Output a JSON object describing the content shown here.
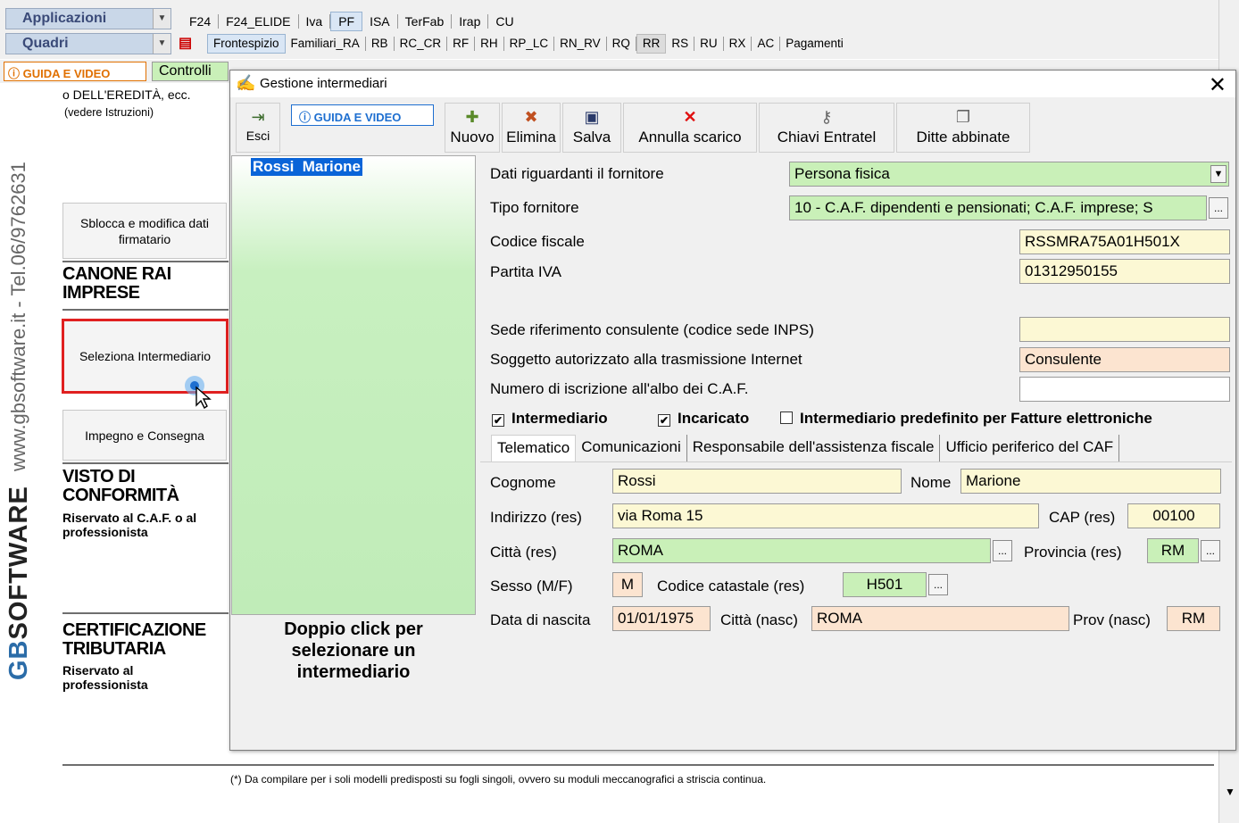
{
  "topbar": {
    "combo1": "Applicazioni",
    "combo2": "Quadri",
    "row1_tabs": [
      "F24",
      "F24_ELIDE",
      "Iva",
      "PF",
      "ISA",
      "TerFab",
      "Irap",
      "CU"
    ],
    "row1_active": "PF",
    "row2_tabs": [
      "Frontespizio",
      "Familiari_RA",
      "RB",
      "RC_CR",
      "RF",
      "RH",
      "RP_LC",
      "RN_RV",
      "RQ",
      "RR",
      "RS",
      "RU",
      "RX",
      "AC",
      "Pagamenti"
    ],
    "row2_active": "RR"
  },
  "subbar": {
    "guida": "GUIDA E VIDEO",
    "controlli": "Controlli"
  },
  "side": {
    "vertical_text": "www.gbsoftware.it - Tel.06/9762631",
    "brand": "SOFTWARE",
    "brand_prefix": "GB"
  },
  "left_form": {
    "eredita": "o DELL'EREDITÀ, ecc.",
    "istruzioni": "(vedere Istruzioni)",
    "sblocca_button": "Sblocca e modifica dati firmatario",
    "canone_title": "CANONE RAI IMPRESE",
    "seleziona_button": "Seleziona Intermediario",
    "impegno_button": "Impegno e Consegna",
    "visto_title": "VISTO DI CONFORMITÀ",
    "visto_sub": "Riservato al C.A.F. o al professionista",
    "cert_title": "CERTIFICAZIONE TRIBUTARIA",
    "cert_sub": "Riservato al professionista",
    "footnote": "(*) Da compilare per i soli modelli predisposti su fogli singoli, ovvero su moduli meccanografici a striscia continua."
  },
  "dialog": {
    "title": "Gestione intermediari",
    "toolbar": {
      "esci": "Esci",
      "guida": "GUIDA E VIDEO",
      "nuovo": "Nuovo",
      "elimina": "Elimina",
      "salva": "Salva",
      "annulla": "Annulla scarico",
      "chiavi": "Chiavi Entratel",
      "ditte": "Ditte abbinate"
    },
    "list": {
      "selected": "Rossi  Marione",
      "hint": "Doppio click per selezionare un intermediario"
    },
    "form": {
      "dati_label": "Dati riguardanti il fornitore",
      "dati_value": "Persona fisica",
      "tipo_label": "Tipo fornitore",
      "tipo_value": "10 - C.A.F. dipendenti e pensionati; C.A.F. imprese; S",
      "cf_label": "Codice fiscale",
      "cf_value": "RSSMRA75A01H501X",
      "piva_label": "Partita IVA",
      "piva_value": "01312950155",
      "sede_label": "Sede riferimento consulente (codice sede INPS)",
      "sede_value": "",
      "soggetto_label": "Soggetto autorizzato alla trasmissione Internet",
      "soggetto_value": "Consulente",
      "numero_label": "Numero di iscrizione all'albo dei C.A.F.",
      "numero_value": "",
      "chk_intermediario": "Intermediario",
      "chk_incaricato": "Incaricato",
      "chk_predefinito": "Intermediario predefinito per Fatture elettroniche",
      "chk_intermediario_checked": true,
      "chk_incaricato_checked": true,
      "chk_predefinito_checked": false
    },
    "subtabs": [
      "Telematico",
      "Comunicazioni",
      "Responsabile dell'assistenza fiscale",
      "Ufficio periferico del CAF"
    ],
    "telematico": {
      "cognome_label": "Cognome",
      "cognome": "Rossi",
      "nome_label": "Nome",
      "nome": "Marione",
      "indirizzo_label": "Indirizzo (res)",
      "indirizzo": "via Roma 15",
      "cap_label": "CAP (res)",
      "cap": "00100",
      "citta_label": "Città (res)",
      "citta": "ROMA",
      "provincia_label": "Provincia (res)",
      "provincia": "RM",
      "sesso_label": "Sesso (M/F)",
      "sesso": "M",
      "codcat_label": "Codice catastale (res)",
      "codcat": "H501",
      "nascita_label": "Data di nascita",
      "nascita": "01/01/1975",
      "citta_nasc_label": "Città (nasc)",
      "citta_nasc": "ROMA",
      "prov_nasc_label": "Prov (nasc)",
      "prov_nasc": "RM"
    }
  }
}
